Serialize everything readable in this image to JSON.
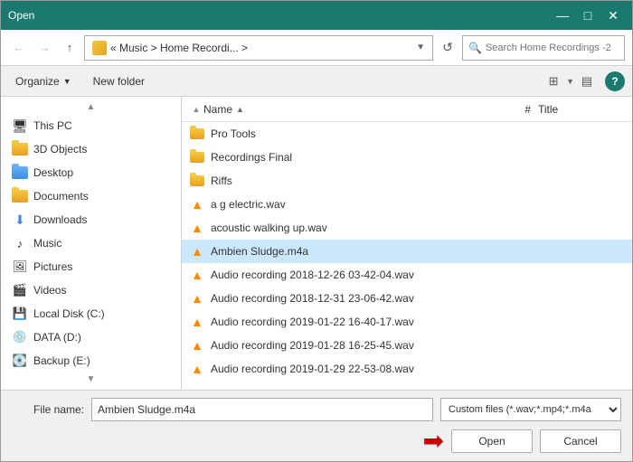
{
  "titlebar": {
    "title": "Open",
    "min_btn": "—",
    "max_btn": "□",
    "close_btn": "✕"
  },
  "addressbar": {
    "back_icon": "←",
    "forward_icon": "→",
    "up_icon": "↑",
    "path_display": "« Music  >  Home Recordi...  >",
    "refresh_icon": "↺",
    "search_placeholder": "Search Home Recordings -2"
  },
  "toolbar": {
    "organize_label": "Organize",
    "new_folder_label": "New folder",
    "view_icon_grid": "⊞",
    "view_icon_list": "▤",
    "help_label": "?"
  },
  "sidebar": {
    "scroll_up": "▲",
    "scroll_down": "▼",
    "items": [
      {
        "id": "this-pc",
        "label": "This PC",
        "icon": "🖥"
      },
      {
        "id": "3d-objects",
        "label": "3D Objects",
        "icon": "folder-yellow"
      },
      {
        "id": "desktop",
        "label": "Desktop",
        "icon": "folder-blue"
      },
      {
        "id": "documents",
        "label": "Documents",
        "icon": "folder-yellow"
      },
      {
        "id": "downloads",
        "label": "Downloads",
        "icon": "download"
      },
      {
        "id": "music",
        "label": "Music",
        "icon": "music"
      },
      {
        "id": "pictures",
        "label": "Pictures",
        "icon": "pictures"
      },
      {
        "id": "videos",
        "label": "Videos",
        "icon": "videos"
      },
      {
        "id": "local-disk-c",
        "label": "Local Disk (C:)",
        "icon": "disk"
      },
      {
        "id": "data-d",
        "label": "DATA (D:)",
        "icon": "disk"
      },
      {
        "id": "backup-e",
        "label": "Backup (E:)",
        "icon": "disk"
      }
    ]
  },
  "filelist": {
    "col_name": "Name",
    "col_hash": "#",
    "col_title": "Title",
    "sort_arrow": "▲",
    "files": [
      {
        "id": "pro-tools",
        "name": "Pro Tools",
        "type": "folder"
      },
      {
        "id": "recordings-final",
        "name": "Recordings Final",
        "type": "folder"
      },
      {
        "id": "riffs",
        "name": "Riffs",
        "type": "folder"
      },
      {
        "id": "a-g-electric",
        "name": "a g electric.wav",
        "type": "vlc"
      },
      {
        "id": "acoustic-walking",
        "name": "acoustic walking up.wav",
        "type": "vlc"
      },
      {
        "id": "ambien-sludge",
        "name": "Ambien Sludge.m4a",
        "type": "vlc",
        "selected": true
      },
      {
        "id": "audio-2018-12-26",
        "name": "Audio recording 2018-12-26 03-42-04.wav",
        "type": "vlc"
      },
      {
        "id": "audio-2018-12-31",
        "name": "Audio recording 2018-12-31 23-06-42.wav",
        "type": "vlc"
      },
      {
        "id": "audio-2019-01-22",
        "name": "Audio recording 2019-01-22 16-40-17.wav",
        "type": "vlc"
      },
      {
        "id": "audio-2019-01-28",
        "name": "Audio recording 2019-01-28 16-25-45.wav",
        "type": "vlc"
      },
      {
        "id": "audio-2019-01-29",
        "name": "Audio recording 2019-01-29 22-53-08.wav",
        "type": "vlc"
      }
    ]
  },
  "bottom": {
    "filename_label": "File name:",
    "filename_value": "Ambien Sludge.m4a",
    "filetype_value": "Custom files (*.wav;*.mp4;*.m4a",
    "open_label": "Open",
    "cancel_label": "Cancel",
    "arrow": "➡"
  }
}
